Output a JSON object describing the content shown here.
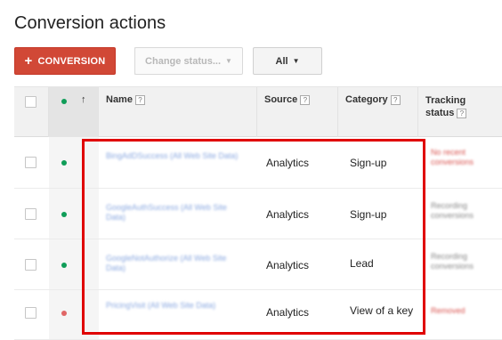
{
  "page": {
    "title": "Conversion actions"
  },
  "toolbar": {
    "conversion_label": "CONVERSION",
    "change_status_label": "Change status...",
    "filter_label": "All"
  },
  "table": {
    "columns": {
      "name": "Name",
      "source": "Source",
      "category": "Category",
      "tracking_line1": "Tracking",
      "tracking_line2": "status",
      "help": "?"
    },
    "status_header_dot_color": "#0f9d58",
    "rows": [
      {
        "status_color": "#0f9d58",
        "source": "Analytics",
        "category": "Sign-up",
        "name_blurred": "BingAdDSuccess (All Web Site Data)",
        "tracking_blurred": "No recent conversions",
        "tracking_tone": "red"
      },
      {
        "status_color": "#0f9d58",
        "source": "Analytics",
        "category": "Sign-up",
        "name_blurred": "GoogleAuthSuccess (All Web Site Data)",
        "tracking_blurred": "Recording conversions",
        "tracking_tone": "gray"
      },
      {
        "status_color": "#0f9d58",
        "source": "Analytics",
        "category": "Lead",
        "name_blurred": "GoogleNotAuthorize (All Web Site Data)",
        "tracking_blurred": "Recording conversions",
        "tracking_tone": "gray"
      },
      {
        "status_color": "#e06666",
        "source": "Analytics",
        "category": "View of a key",
        "name_blurred": "PricingVisit (All Web Site Data)",
        "tracking_blurred": "Removed",
        "tracking_tone": "red"
      }
    ]
  },
  "colors": {
    "accent": "#d14836",
    "highlight": "#e00000"
  },
  "icons": {
    "plus": "plus-icon",
    "caret": "caret-down-icon",
    "sort": "sort-up-arrow-icon",
    "help": "help-icon"
  }
}
